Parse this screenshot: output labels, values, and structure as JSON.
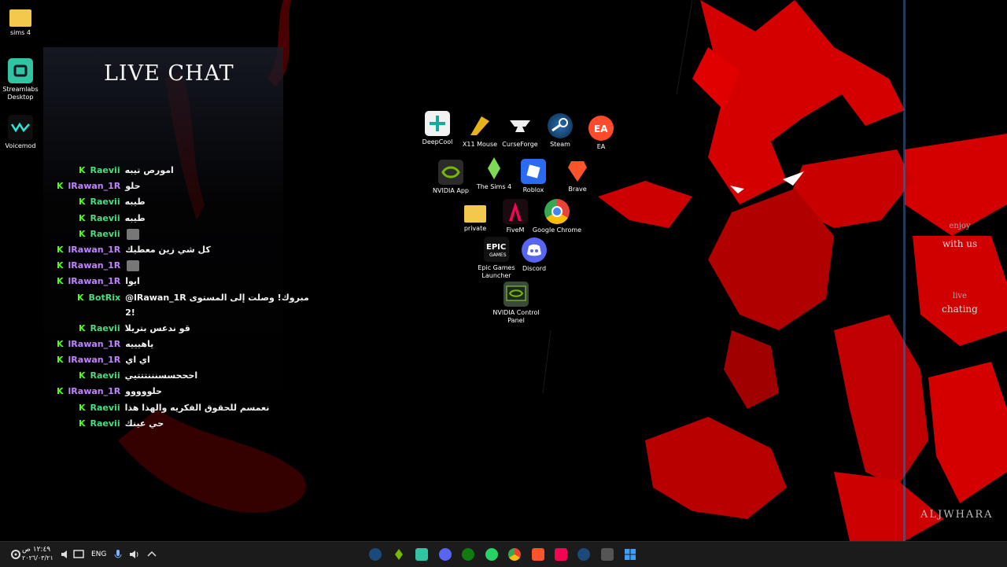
{
  "desktop_left": [
    {
      "label": "sims 4",
      "icon": "folder-icon"
    },
    {
      "label": "Streamlabs Desktop",
      "icon": "streamlabs-icon"
    },
    {
      "label": "Voicemod",
      "icon": "voicemod-icon"
    }
  ],
  "desktop_center": [
    {
      "label": "DeepCool",
      "icon": "deepcool-icon"
    },
    {
      "label": "X11 Mouse",
      "icon": "x11-mouse-icon"
    },
    {
      "label": "CurseForge",
      "icon": "curseforge-icon"
    },
    {
      "label": "Steam",
      "icon": "steam-icon"
    },
    {
      "label": "EA",
      "icon": "ea-icon"
    },
    {
      "label": "NVIDIA App",
      "icon": "nvidia-icon"
    },
    {
      "label": "The Sims 4",
      "icon": "sims-icon"
    },
    {
      "label": "Roblox",
      "icon": "roblox-icon"
    },
    {
      "label": "Brave",
      "icon": "brave-icon"
    },
    {
      "label": "private",
      "icon": "folder-icon"
    },
    {
      "label": "FiveM",
      "icon": "fivem-icon"
    },
    {
      "label": "Google Chrome",
      "icon": "chrome-icon"
    },
    {
      "label": "Epic Games Launcher",
      "icon": "epic-icon"
    },
    {
      "label": "Discord",
      "icon": "discord-icon"
    },
    {
      "label": "NVIDIA Control Panel",
      "icon": "nvidia-control-icon"
    }
  ],
  "chat": {
    "title": "LIVE CHAT",
    "messages": [
      {
        "user": "Raevii",
        "text": "امورص تيبه",
        "color": "#4ade80"
      },
      {
        "user": "lRawan_1R",
        "text": "حلو",
        "color": "#c084fc"
      },
      {
        "user": "Raevii",
        "text": "طيبه",
        "color": "#4ade80"
      },
      {
        "user": "Raevii",
        "text": "طيبه",
        "color": "#4ade80"
      },
      {
        "user": "Raevii",
        "text": "",
        "color": "#4ade80",
        "emote": true
      },
      {
        "user": "lRawan_1R",
        "text": "كل شي زين معطيك",
        "color": "#c084fc"
      },
      {
        "user": "lRawan_1R",
        "text": "",
        "color": "#c084fc",
        "emote": true
      },
      {
        "user": "lRawan_1R",
        "text": "ايوا",
        "color": "#c084fc"
      },
      {
        "user": "BotRix",
        "text": "@lRawan_1R مبروك! وصلت إلى المستوى",
        "text2": "2!",
        "color": "#4ade80"
      },
      {
        "user": "Raevii",
        "text": "قو ندعس بتريلا",
        "color": "#4ade80"
      },
      {
        "user": "lRawan_1R",
        "text": "ياهيييه",
        "color": "#c084fc"
      },
      {
        "user": "lRawan_1R",
        "text": "اي اي",
        "color": "#c084fc"
      },
      {
        "user": "Raevii",
        "text": "احححسسنننتتتيي",
        "color": "#4ade80"
      },
      {
        "user": "lRawan_1R",
        "text": "حلووووو",
        "color": "#c084fc"
      },
      {
        "user": "Raevii",
        "text": "نعمسم للحقوق الفكريه والهذا هذا",
        "color": "#4ade80"
      },
      {
        "user": "Raevii",
        "text": "حي عينك",
        "color": "#4ade80"
      }
    ]
  },
  "overlay_right": {
    "enjoy": "enjoy",
    "with_us": "with us",
    "live": "live",
    "chating": "chating",
    "signature": "ALJWHARA"
  },
  "taskbar": {
    "time": "١٢:٤٩ ص",
    "date": "٢٠٢٦/٠٣/٢١",
    "language": "ENG",
    "tray_icons": [
      "settings-icon",
      "volume-mute-icon",
      "display-icon",
      "language-indicator",
      "microphone-icon",
      "speaker-icon",
      "chevron-up-icon"
    ],
    "apps": [
      "steam-icon",
      "nvidia-icon",
      "streamlabs-icon",
      "discord-icon",
      "xbox-icon",
      "whatsapp-icon",
      "chrome-icon",
      "brave-icon",
      "fivem-icon",
      "steam-icon",
      "unity-icon",
      "windows-start-icon"
    ]
  }
}
